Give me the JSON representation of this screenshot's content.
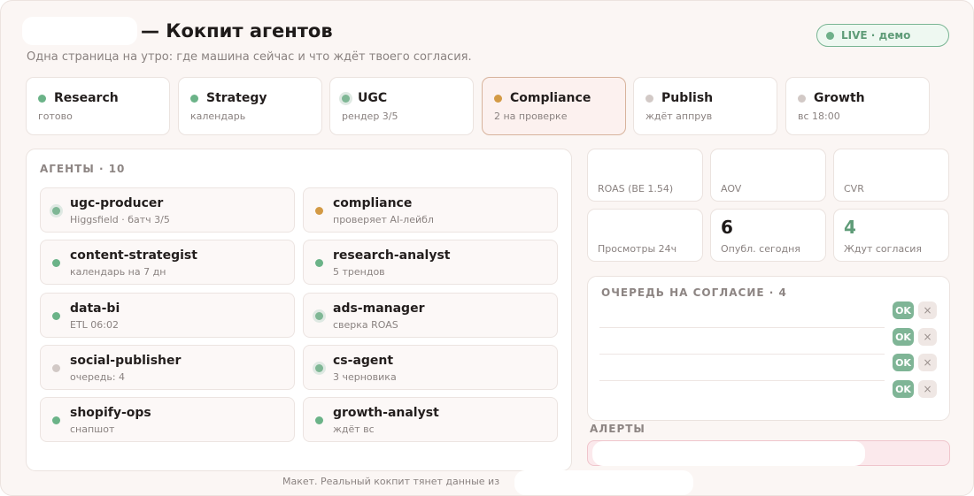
{
  "header": {
    "title": "— Кокпит агентов",
    "subtitle": "Одна страница на утро: где машина сейчас и что ждёт твоего согласия.",
    "live_badge": "LIVE · демо"
  },
  "stages": [
    {
      "name": "Research",
      "status": "готово",
      "dot": "green"
    },
    {
      "name": "Strategy",
      "status": "календарь",
      "dot": "green"
    },
    {
      "name": "UGC",
      "status": "рендер 3/5",
      "dot": "halo"
    },
    {
      "name": "Compliance",
      "status": "2 на проверке",
      "dot": "orange",
      "active": true
    },
    {
      "name": "Publish",
      "status": "ждёт аппрув",
      "dot": "grey"
    },
    {
      "name": "Growth",
      "status": "вс 18:00",
      "dot": "grey"
    }
  ],
  "agents_panel": {
    "label": "АГЕНТЫ · 10",
    "agents": [
      {
        "name": "ugc-producer",
        "status": "Higgsfield · батч 3/5",
        "dot": "halo"
      },
      {
        "name": "compliance",
        "status": "проверяет AI-лейбл",
        "dot": "orange"
      },
      {
        "name": "content-strategist",
        "status": "календарь на 7 дн",
        "dot": "green"
      },
      {
        "name": "research-analyst",
        "status": "5 трендов",
        "dot": "green"
      },
      {
        "name": "data-bi",
        "status": "ETL 06:02",
        "dot": "green"
      },
      {
        "name": "ads-manager",
        "status": "сверка ROAS",
        "dot": "halo"
      },
      {
        "name": "social-publisher",
        "status": "очередь: 4",
        "dot": "grey"
      },
      {
        "name": "cs-agent",
        "status": "3 черновика",
        "dot": "halo"
      },
      {
        "name": "shopify-ops",
        "status": "снапшот",
        "dot": "green"
      },
      {
        "name": "growth-analyst",
        "status": "ждёт вс",
        "dot": "green"
      }
    ]
  },
  "kpis": [
    {
      "value": "",
      "label": "ROAS (BE 1.54)"
    },
    {
      "value": "",
      "label": "AOV"
    },
    {
      "value": "",
      "label": "CVR"
    },
    {
      "value": "",
      "label": "Просмотры 24ч"
    },
    {
      "value": "6",
      "label": "Опубл. сегодня"
    },
    {
      "value": "4",
      "label": "Ждут согласия",
      "accent": true
    }
  ],
  "queue": {
    "label": "ОЧЕРЕДЬ НА СОГЛАСИЕ · 4",
    "approve_label": "OK",
    "reject_label": "×"
  },
  "alerts": {
    "label": "АЛЕРТЫ"
  },
  "footer": "Макет. Реальный кокпит тянет данные из",
  "colors": {
    "green": "#6bb388",
    "orange": "#d39a45",
    "grey": "#d2c9c6",
    "active_border": "#d7b39c",
    "alert_bg": "#fbe9ec"
  }
}
